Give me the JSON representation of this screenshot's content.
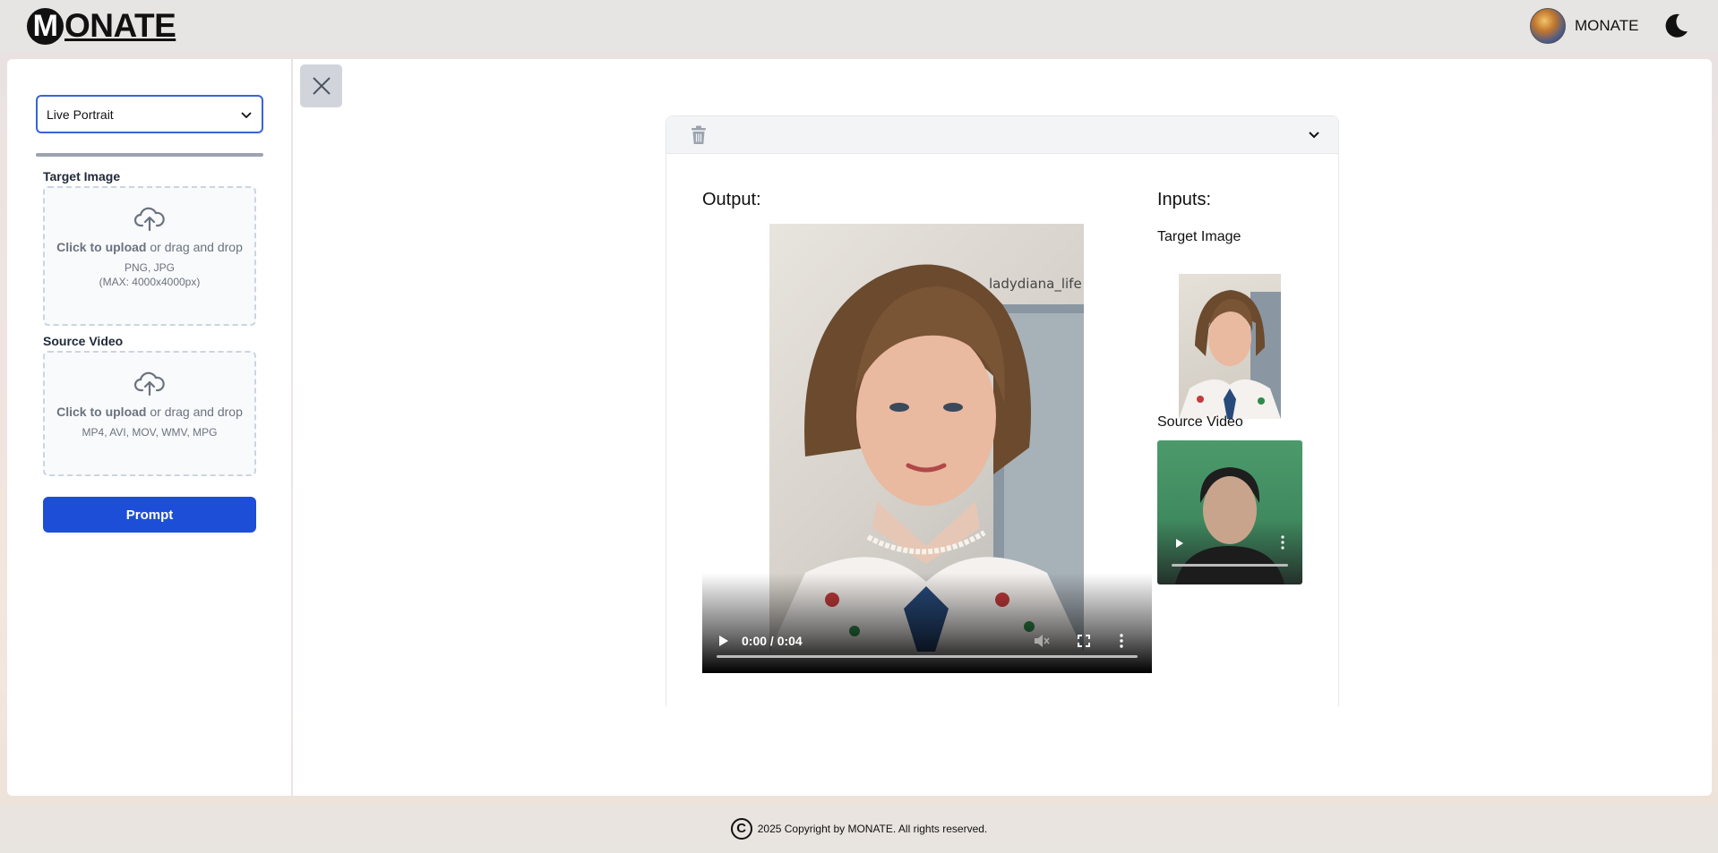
{
  "header": {
    "logo_letter": "M",
    "logo_rest": "ONATE",
    "user_name": "MONATE"
  },
  "sidebar": {
    "mode_select": {
      "value": "Live Portrait",
      "options": [
        "Live Portrait"
      ]
    },
    "target_image": {
      "label": "Target Image",
      "upload_strong": "Click to upload",
      "upload_rest": " or drag and drop",
      "formats": "PNG, JPG",
      "max": "(MAX: 4000x4000px)"
    },
    "source_video": {
      "label": "Source Video",
      "upload_strong": "Click to upload",
      "upload_rest": " or drag and drop",
      "formats": "MP4, AVI, MOV, WMV, MPG"
    },
    "prompt_button": "Prompt"
  },
  "result_card": {
    "output_label": "Output:",
    "inputs_label": "Inputs:",
    "target_image_label": "Target Image",
    "source_video_label": "Source Video",
    "watermark": "ladydiana_life",
    "video_time": "0:00 / 0:04"
  },
  "footer": {
    "copyright": "2025 Copyright by MONATE. All rights reserved."
  },
  "colors": {
    "accent_blue": "#1d4ed8",
    "select_border": "#3b63d6"
  }
}
